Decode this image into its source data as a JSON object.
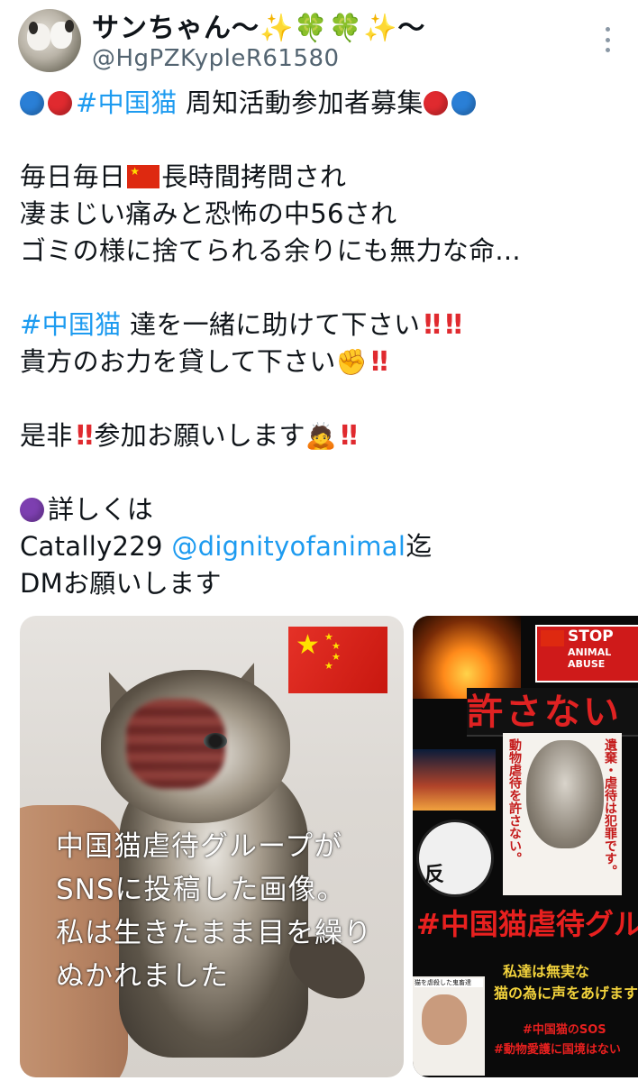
{
  "user": {
    "display_name": "サンちゃん〜✨🍀🍀✨〜",
    "handle": "@HgPZKypleR61580"
  },
  "tweet": {
    "line1_hashtag": "#中国猫",
    "line1_text": " 周知活動参加者募集",
    "line2_a": "毎日毎日",
    "line2_b": "長時間拷問され",
    "line3": "凄まじい痛みと恐怖の中56され",
    "line4": "ゴミの様に捨てられる余りにも無力な命...",
    "line5_hashtag": "#中国猫",
    "line5_text": " 達を一緒に助けて下さい",
    "line6_text": "貴方のお力を貸して下さい",
    "line7_a": "是非",
    "line7_b": "参加お願いします",
    "line8_text": "詳しくは",
    "line9_a": "Catally229 ",
    "line9_mention": "@dignityofanimal",
    "line9_b": "迄",
    "line10": "DMお願いします",
    "bang": "‼",
    "fist_emoji": "✊",
    "bow_emoji": "🙇"
  },
  "media": {
    "photo1_caption": [
      "中国猫虐待グループが",
      "SNSに投稿した画像。",
      "私は生きたまま目を繰り",
      "ぬかれました"
    ],
    "photo2": {
      "stop": "STOP",
      "animal_abuse": "ANIMAL\nABUSE",
      "yurusanai": "許さない",
      "vertical_left": "動物虐待を許さない。",
      "vertical_right": "遺棄・虐待は犯罪です。",
      "han": "反",
      "hashtitle": "#中国猫虐待グル",
      "bottom1": "私達は無実な",
      "bottom2": "猫の為に声をあげます",
      "thumb_label": "猫を虐殺した鬼畜達",
      "sos1": "#中国猫のSOS",
      "sos2": "#動物愛護に国境はない"
    }
  },
  "icons": [
    "avatar",
    "more-icon",
    "blue-circle-icon",
    "red-circle-icon",
    "purple-circle-icon",
    "china-flag-icon",
    "double-exclamation-icon",
    "raised-fist-icon",
    "bowing-person-icon"
  ],
  "colors": {
    "link": "#1d9bf0",
    "text": "#0f1419",
    "secondary": "#536471",
    "alert_red": "#e02a2f"
  }
}
